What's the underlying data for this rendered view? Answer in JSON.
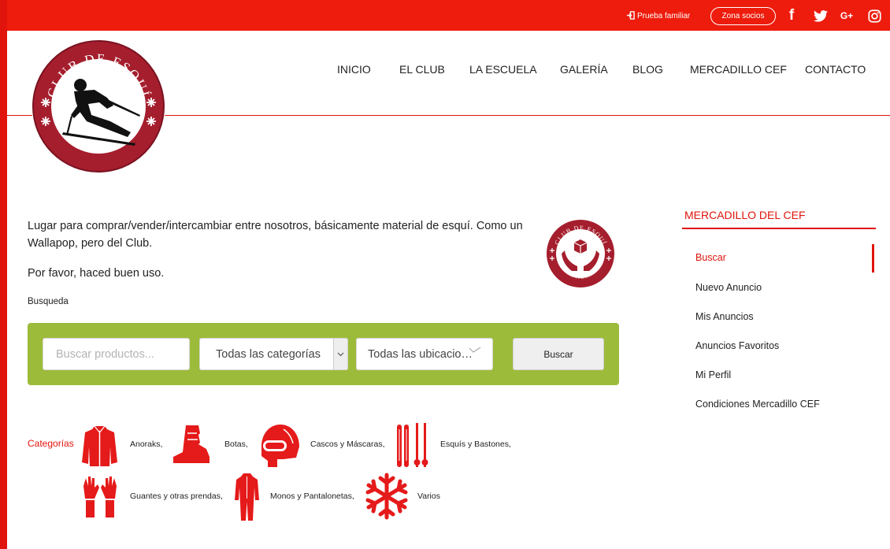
{
  "topbar": {
    "trial_label": "Prueba familiar",
    "members_label": "Zona socios",
    "social": {
      "facebook": "f",
      "googleplus": "G+"
    }
  },
  "logo": {
    "text_top": "CLUB DE ESQUÍ",
    "text_bottom": "FAMILIAR"
  },
  "nav": {
    "items": [
      {
        "label": "INICIO"
      },
      {
        "label": "EL CLUB"
      },
      {
        "label": "LA ESCUELA"
      },
      {
        "label": "GALERÍA"
      },
      {
        "label": "BLOG"
      },
      {
        "label": "MERCADILLO CEF"
      },
      {
        "label": "CONTACTO"
      }
    ]
  },
  "intro": {
    "line1": "Lugar para comprar/vender/intercambiar entre nosotros, básicamente material de esquí. Como un Wallapop, pero del Club.",
    "line2": "Por favor, haced buen uso.",
    "search_label": "Busqueda"
  },
  "search": {
    "placeholder": "Buscar productos...",
    "category_value": "Todas las categorías",
    "location_value": "Todas las ubicaciones",
    "button_label": "Buscar"
  },
  "categories": {
    "title": "Categorías",
    "items": [
      {
        "label": "Anoraks,",
        "icon": "jacket-icon"
      },
      {
        "label": "Botas,",
        "icon": "boot-icon"
      },
      {
        "label": "Cascos y Máscaras,",
        "icon": "helmet-icon"
      },
      {
        "label": "Esquís y Bastones,",
        "icon": "skis-icon"
      },
      {
        "label": "Guantes y otras prendas,",
        "icon": "gloves-icon"
      },
      {
        "label": "Monos y Pantalonetas,",
        "icon": "suit-icon"
      },
      {
        "label": "Varios",
        "icon": "snowflake-icon"
      }
    ]
  },
  "sidebar": {
    "title": "MERCADILLO DEL CEF",
    "items": [
      {
        "label": "Buscar",
        "active": true
      },
      {
        "label": "Nuevo Anuncio"
      },
      {
        "label": "Mis Anuncios"
      },
      {
        "label": "Anuncios Favoritos"
      },
      {
        "label": "Mi Perfil"
      },
      {
        "label": "Condiciones Mercadillo CEF"
      }
    ]
  },
  "colors": {
    "brand_red": "#ee1c0c",
    "search_green": "#9dbb3a",
    "logo_maroon": "#a51e2d"
  }
}
